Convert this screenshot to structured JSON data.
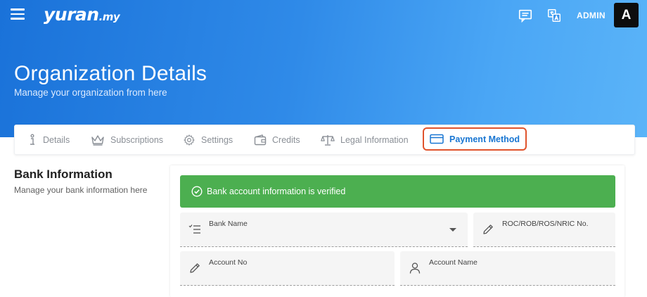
{
  "app": {
    "logo_main": "yuran",
    "logo_tld": ".my",
    "user_role": "ADMIN",
    "avatar_initial": "A"
  },
  "header": {
    "title": "Organization Details",
    "subtitle": "Manage your organization from here"
  },
  "tabs": [
    {
      "label": "Details",
      "icon": "info-icon",
      "active": false
    },
    {
      "label": "Subscriptions",
      "icon": "crown-icon",
      "active": false
    },
    {
      "label": "Settings",
      "icon": "gear-icon",
      "active": false
    },
    {
      "label": "Credits",
      "icon": "wallet-icon",
      "active": false
    },
    {
      "label": "Legal Information",
      "icon": "scale-icon",
      "active": false
    },
    {
      "label": "Payment Method",
      "icon": "credit-card-icon",
      "active": true
    }
  ],
  "section": {
    "title": "Bank Information",
    "description": "Manage your bank information here"
  },
  "alert": {
    "message": "Bank account information is verified",
    "color": "#4caf50"
  },
  "form": {
    "bank_name_label": "Bank Name",
    "roc_label": "ROC/ROB/ROS/NRIC No.",
    "account_no_label": "Account No",
    "account_name_label": "Account Name"
  },
  "colors": {
    "primary": "#1976d2",
    "highlight_border": "#e0532c"
  }
}
